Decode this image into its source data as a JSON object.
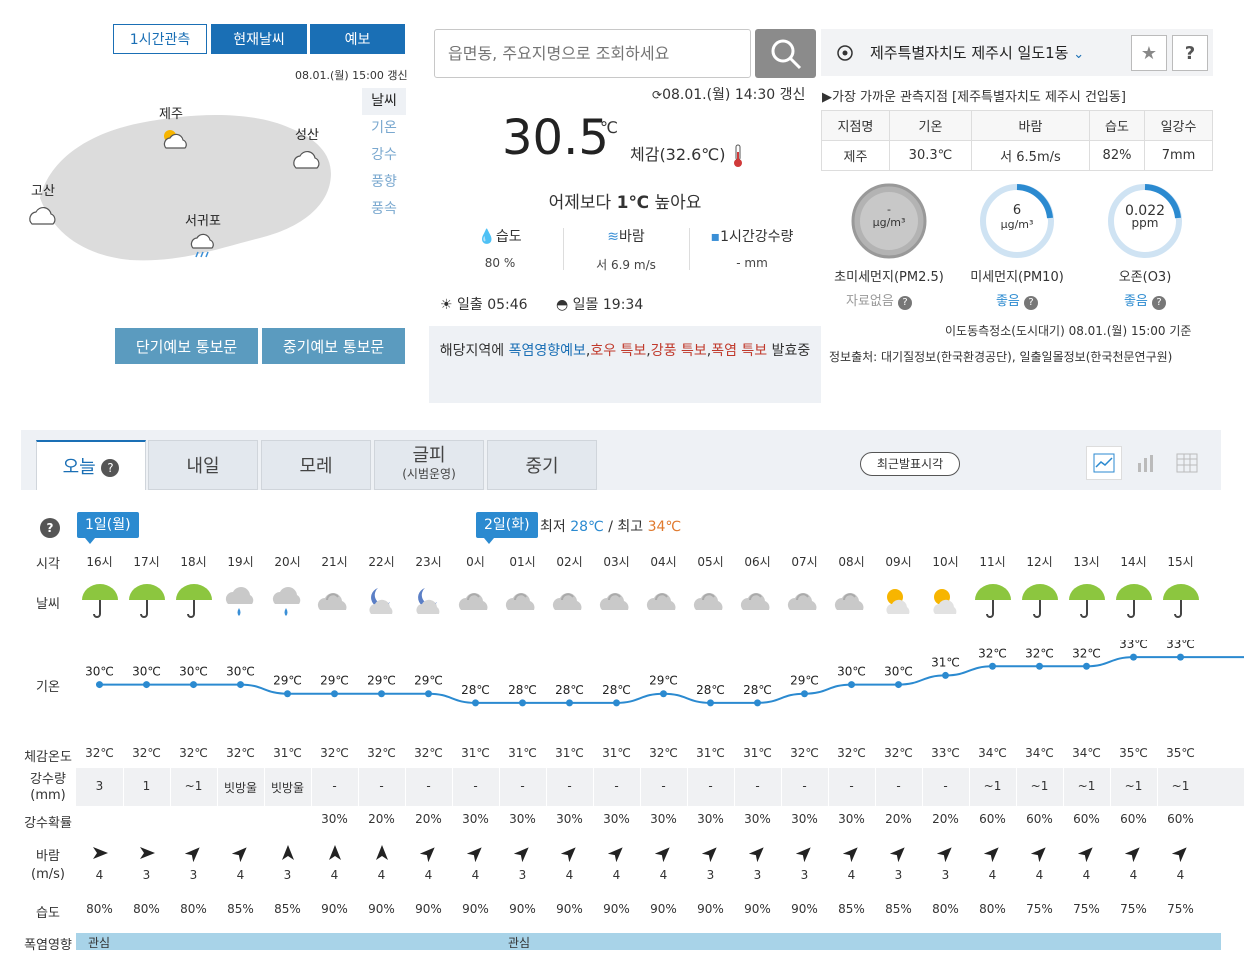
{
  "map_panel": {
    "tabs": [
      "1시간관측",
      "현재날씨",
      "예보"
    ],
    "updated": "08.01.(월) 15:00 갱신",
    "options": [
      "날씨",
      "기온",
      "강수",
      "풍향",
      "풍속"
    ],
    "cities": [
      "제주",
      "성산",
      "고산",
      "서귀포"
    ],
    "buttons": [
      "단기예보 통보문",
      "중기예보 통보문"
    ]
  },
  "search": {
    "placeholder": "읍면동, 주요지명으로 조회하세요"
  },
  "location": {
    "name": "제주특별자치도 제주시 일도1동",
    "favorite": "★",
    "help": "?"
  },
  "current": {
    "updated": "08.01.(월) 14:30 갱신",
    "temp": "30.5",
    "unit": "℃",
    "feels": "체감(32.6℃)",
    "compare_pre": "어제보다",
    "compare_val": "1℃",
    "compare_post": "높아요",
    "humidity_label": "습도",
    "humidity": "80 %",
    "wind_label": "바람",
    "wind": "서 6.9 m/s",
    "rain_label": "1시간강수량",
    "rain": "- mm",
    "sunrise_label": "일출",
    "sunrise": "05:46",
    "sunset_label": "일몰",
    "sunset": "19:34"
  },
  "warning": {
    "pre": "해당지역에",
    "items": [
      "폭염영향예보",
      "호우 특보",
      "강풍 특보",
      "폭염 특보"
    ],
    "post": "발효중"
  },
  "observation": {
    "title": "▶가장 가까운 관측지점 [제주특별자치도 제주시 건입동]",
    "headers": [
      "지점명",
      "기온",
      "바람",
      "습도",
      "일강수"
    ],
    "row": [
      "제주",
      "30.3℃",
      "서 6.5m/s",
      "82%",
      "7mm"
    ]
  },
  "air": {
    "pm25": {
      "value": "-",
      "unit": "μg/m³",
      "label": "초미세먼지(PM2.5)",
      "status": "자료없음"
    },
    "pm10": {
      "value": "6",
      "unit": "μg/m³",
      "label": "미세먼지(PM10)",
      "status": "좋음"
    },
    "o3": {
      "value": "0.022",
      "unit": "ppm",
      "label": "오존(O3)",
      "status": "좋음"
    },
    "station": "이도동측정소(도시대기) 08.01.(월) 15:00 기준",
    "source": "정보출처: 대기질정보(한국환경공단), 일출일몰정보(한국천문연구원)"
  },
  "forecast": {
    "tabs": [
      {
        "label": "오늘",
        "sub": ""
      },
      {
        "label": "내일",
        "sub": ""
      },
      {
        "label": "모레",
        "sub": ""
      },
      {
        "label": "글피",
        "sub": "(시범운영)"
      },
      {
        "label": "중기",
        "sub": ""
      }
    ],
    "recent_btn": "최근발표시각",
    "day1": "1일(월)",
    "day2": "2일(화)",
    "min_label": "최저",
    "min_val": "28℃",
    "max_label": "최고",
    "max_val": "34℃",
    "row_labels": {
      "time": "시각",
      "weather": "날씨",
      "temp": "기온",
      "feels": "체감온도",
      "rain": "강수량",
      "rain_unit": "(mm)",
      "prob": "강수확률",
      "wind": "바람",
      "wind_unit": "(m/s)",
      "humid": "습도",
      "heat": "폭염영향"
    },
    "hours": [
      "16시",
      "17시",
      "18시",
      "19시",
      "20시",
      "21시",
      "22시",
      "23시",
      "0시",
      "01시",
      "02시",
      "03시",
      "04시",
      "05시",
      "06시",
      "07시",
      "08시",
      "09시",
      "10시",
      "11시",
      "12시",
      "13시",
      "14시",
      "15시"
    ],
    "weather": [
      "umbrella",
      "umbrella",
      "umbrella",
      "rain-cloud",
      "rain-cloud",
      "cloud",
      "moon-cloud",
      "moon-cloud",
      "cloud",
      "cloud",
      "cloud",
      "cloud",
      "cloud",
      "cloud",
      "cloud",
      "cloud",
      "cloud",
      "sun-cloud",
      "sun-cloud",
      "umbrella",
      "umbrella",
      "umbrella",
      "umbrella",
      "umbrella"
    ],
    "temps": [
      30,
      30,
      30,
      30,
      29,
      29,
      29,
      29,
      28,
      28,
      28,
      28,
      29,
      28,
      28,
      29,
      30,
      30,
      31,
      32,
      32,
      32,
      33,
      33
    ],
    "temp_labels": [
      "30℃",
      "30℃",
      "30℃",
      "30℃",
      "29℃",
      "29℃",
      "29℃",
      "29℃",
      "28℃",
      "28℃",
      "28℃",
      "28℃",
      "29℃",
      "28℃",
      "28℃",
      "29℃",
      "30℃",
      "30℃",
      "31℃",
      "32℃",
      "32℃",
      "32℃",
      "33℃",
      "33℃"
    ],
    "feels": [
      "32℃",
      "32℃",
      "32℃",
      "32℃",
      "31℃",
      "32℃",
      "32℃",
      "32℃",
      "31℃",
      "31℃",
      "31℃",
      "31℃",
      "32℃",
      "31℃",
      "31℃",
      "32℃",
      "32℃",
      "32℃",
      "33℃",
      "34℃",
      "34℃",
      "34℃",
      "35℃",
      "35℃"
    ],
    "rain": [
      "3",
      "1",
      "~1",
      "빗방울",
      "빗방울",
      "-",
      "-",
      "-",
      "-",
      "-",
      "-",
      "-",
      "-",
      "-",
      "-",
      "-",
      "-",
      "-",
      "-",
      "~1",
      "~1",
      "~1",
      "~1",
      "~1"
    ],
    "prob": [
      "",
      "",
      "",
      "",
      "",
      "30%",
      "20%",
      "20%",
      "30%",
      "30%",
      "30%",
      "30%",
      "30%",
      "30%",
      "30%",
      "30%",
      "30%",
      "20%",
      "20%",
      "60%",
      "60%",
      "60%",
      "60%",
      "60%"
    ],
    "wind_dir": [
      90,
      90,
      45,
      45,
      0,
      0,
      0,
      45,
      45,
      45,
      45,
      45,
      45,
      45,
      45,
      45,
      45,
      45,
      45,
      45,
      45,
      45,
      45,
      45
    ],
    "wind_speed": [
      "4",
      "3",
      "3",
      "4",
      "3",
      "4",
      "4",
      "4",
      "4",
      "3",
      "4",
      "4",
      "4",
      "3",
      "3",
      "3",
      "4",
      "3",
      "3",
      "4",
      "4",
      "4",
      "4",
      "4"
    ],
    "humid": [
      "80%",
      "80%",
      "80%",
      "85%",
      "85%",
      "90%",
      "90%",
      "90%",
      "90%",
      "90%",
      "90%",
      "90%",
      "90%",
      "90%",
      "90%",
      "90%",
      "85%",
      "85%",
      "80%",
      "80%",
      "75%",
      "75%",
      "75%",
      "75%"
    ],
    "heat": [
      {
        "label": "관심"
      },
      {
        "label": "관심"
      }
    ]
  }
}
